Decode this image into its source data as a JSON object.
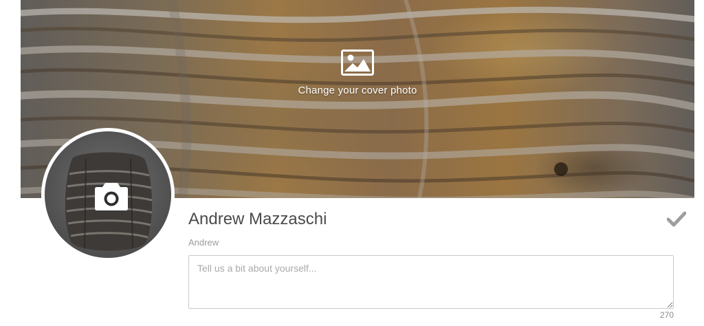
{
  "cover": {
    "cta_label": "Change your cover photo",
    "cta_icon": "image-icon"
  },
  "avatar": {
    "icon": "camera-icon"
  },
  "profile": {
    "full_name": "Andrew Mazzaschi",
    "first_name": "Andrew",
    "save_icon": "checkmark-icon"
  },
  "bio": {
    "value": "",
    "placeholder": "Tell us a bit about yourself...",
    "remaining_chars": "270"
  },
  "colors": {
    "text_primary": "#4a4a4a",
    "text_muted": "#9b9b9b",
    "border": "#c9c9c9",
    "check": "#9e9e9e"
  }
}
